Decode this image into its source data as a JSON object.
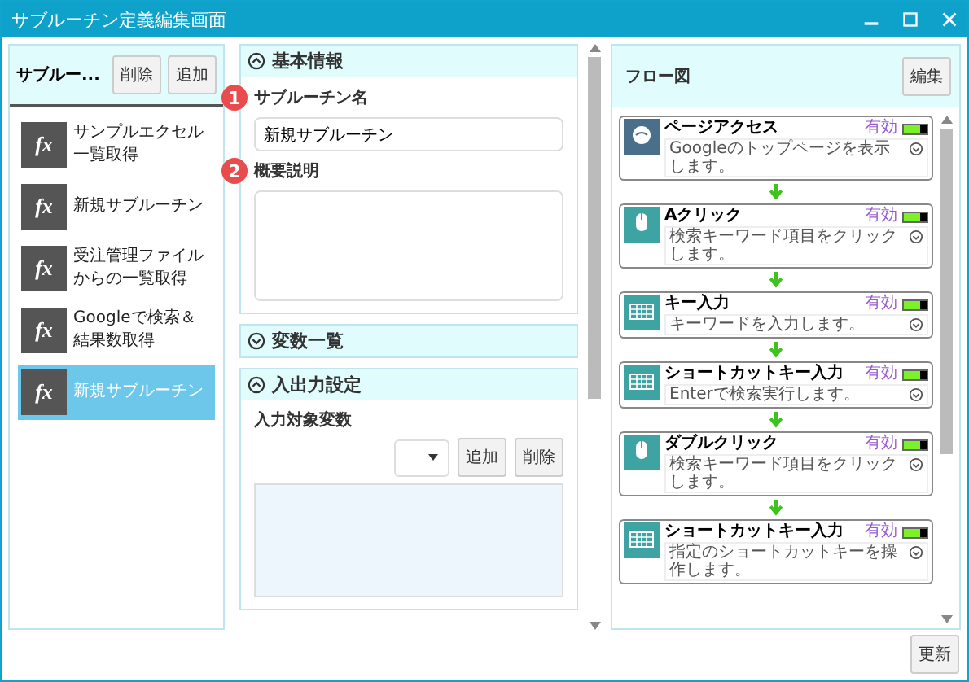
{
  "window": {
    "title": "サブルーチン定義編集画面"
  },
  "subroutine_panel": {
    "title": "サブルー...",
    "buttons": [
      "削除",
      "追加"
    ],
    "items": [
      {
        "icon": "fx",
        "label": "サンプルエクセル一覧取得",
        "selected": false
      },
      {
        "icon": "fx",
        "label": "新規サブルーチン",
        "selected": false
      },
      {
        "icon": "fx",
        "label": "受注管理ファイルからの一覧取得",
        "selected": false
      },
      {
        "icon": "fx",
        "label": "Googleで検索＆結果数取得",
        "selected": false
      },
      {
        "icon": "fx",
        "label": "新規サブルーチン",
        "selected": true
      }
    ]
  },
  "sections": [
    {
      "title": "基本情報",
      "expanded": true,
      "kind": "basic",
      "fields": [
        {
          "badge": "1",
          "label": "サブルーチン名",
          "value": "新規サブルーチン",
          "kind": "input"
        },
        {
          "badge": "2",
          "label": "概要説明",
          "kind": "textarea"
        }
      ]
    },
    {
      "title": "変数一覧",
      "expanded": false
    },
    {
      "title": "入出力設定",
      "expanded": true,
      "kind": "io",
      "label": "入力対象変数",
      "buttons": [
        "追加",
        "削除"
      ]
    }
  ],
  "flow": {
    "title": "フロー図",
    "edit_button": "編集",
    "nodes": [
      {
        "title": "ページアクセス",
        "description": "Googleのトップページを表示します。",
        "kind": "web",
        "status": "有効",
        "on": true
      },
      {
        "title": "Aクリック",
        "description": "検索キーワード項目をクリックします。",
        "kind": "mouse",
        "status": "有効",
        "on": true
      },
      {
        "title": "キー入力",
        "description": "キーワードを入力します。",
        "kind": "key",
        "status": "有効",
        "on": true
      },
      {
        "title": "ショートカットキー入力",
        "description": "Enterで検索実行します。",
        "kind": "key",
        "status": "有効",
        "on": true
      },
      {
        "title": "ダブルクリック",
        "description": "検索キーワード項目をクリックします。",
        "kind": "mouse",
        "status": "有効",
        "on": true
      },
      {
        "title": "ショートカットキー入力",
        "description": "指定のショートカットキーを操作します。",
        "kind": "key",
        "status": "有効",
        "on": true
      }
    ]
  },
  "footer": {
    "button": "更新"
  }
}
